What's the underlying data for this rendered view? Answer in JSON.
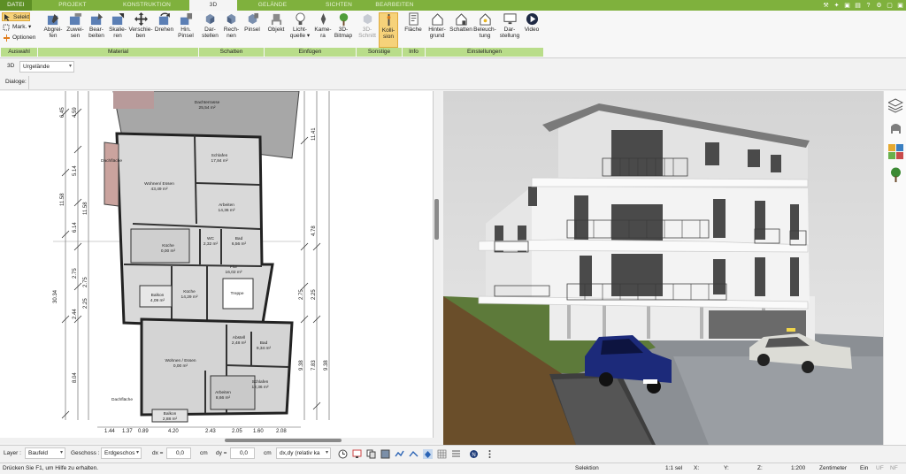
{
  "tabs": [
    {
      "label": "DATEI",
      "active": false
    },
    {
      "label": "PROJEKT",
      "active": false
    },
    {
      "label": "KONSTRUKTION",
      "active": false
    },
    {
      "label": "3D",
      "active": true
    },
    {
      "label": "GELÄNDE",
      "active": false
    },
    {
      "label": "SICHTEN",
      "active": false
    },
    {
      "label": "BEARBEITEN",
      "active": false
    }
  ],
  "ribbon": {
    "auswahl": {
      "label": "Auswahl",
      "selekt": "Selekt",
      "mark": "Mark.",
      "optionen": "Optionen"
    },
    "material": {
      "label": "Material",
      "buttons": [
        {
          "line1": "Abgrei-",
          "line2": "fen"
        },
        {
          "line1": "Zuwei-",
          "line2": "sen"
        },
        {
          "line1": "Bear-",
          "line2": "beiten"
        },
        {
          "line1": "Skalie-",
          "line2": "ren"
        },
        {
          "line1": "Verschie-",
          "line2": "ben"
        },
        {
          "line1": "Drehen",
          "line2": ""
        },
        {
          "line1": "Hin.",
          "line2": "Pinsel"
        }
      ]
    },
    "schatten": {
      "label": "Schatten",
      "buttons": [
        {
          "line1": "Dar-",
          "line2": "stellen"
        },
        {
          "line1": "Rech-",
          "line2": "nen"
        },
        {
          "line1": "Pinsel",
          "line2": ""
        }
      ]
    },
    "einfuegen": {
      "label": "Einfügen",
      "buttons": [
        {
          "line1": "Objekt",
          "line2": ""
        },
        {
          "line1": "Licht-",
          "line2": "quelle ▾"
        },
        {
          "line1": "Kame-",
          "line2": "ra"
        },
        {
          "line1": "3D-",
          "line2": "Bitmap"
        }
      ]
    },
    "sonstige": {
      "label": "Sonstige",
      "buttons": [
        {
          "line1": "3D-",
          "line2": "Schnitt"
        },
        {
          "line1": "Kolli-",
          "line2": "sion"
        }
      ]
    },
    "info": {
      "label": "Info",
      "buttons": [
        {
          "line1": "Fläche",
          "line2": ""
        }
      ]
    },
    "einstellungen": {
      "label": "Einstellungen",
      "buttons": [
        {
          "line1": "Hinter-",
          "line2": "grund"
        },
        {
          "line1": "Schatten",
          "line2": ""
        },
        {
          "line1": "Beleuch-",
          "line2": "tung"
        },
        {
          "line1": "Dar-",
          "line2": "stellung"
        },
        {
          "line1": "Video",
          "line2": ""
        }
      ]
    }
  },
  "row1": {
    "view_label": "3D",
    "terrain_value": "Urgelände"
  },
  "row2": {
    "dialoge_label": "Dialoge:"
  },
  "plan": {
    "rooms": [
      {
        "name": "Dachterrasse",
        "area": "25,54 m²"
      },
      {
        "name": "Schlafen",
        "area": "17,84 m²"
      },
      {
        "name": "Wohnen/ Essen",
        "area": "43,49 m²"
      },
      {
        "name": "Arbeiten",
        "area": "14,36 m²"
      },
      {
        "name": "Küche",
        "area": "0,00 m²"
      },
      {
        "name": "WC",
        "area": "2,32 m²"
      },
      {
        "name": "Bad",
        "area": "6,56 m²"
      },
      {
        "name": "Flur",
        "area": "16,02 m²"
      },
      {
        "name": "Küche",
        "area": "14,29 m²"
      },
      {
        "name": "Balkon",
        "area": "4,09 m²"
      },
      {
        "name": "Abstell",
        "area": "2,48 m²"
      },
      {
        "name": "Bad",
        "area": "9,34 m²"
      },
      {
        "name": "Wohnen / Essen",
        "area": "0,00 m²"
      },
      {
        "name": "Arbeiten",
        "area": "8,66 m²"
      },
      {
        "name": "Schlafen",
        "area": "12,36 m²"
      },
      {
        "name": "Balkon",
        "area": "2,88 m²"
      }
    ],
    "misc_labels": [
      "Dachfläche",
      "Dachfläche",
      "Treppe"
    ],
    "left_dims_outer": [
      "6.45",
      "11.58",
      "30.34"
    ],
    "left_dims_mid": [
      "4.59",
      "5.14",
      "6.14",
      "2.75",
      "2.44",
      "8.04"
    ],
    "left_dims_inner": [
      "2.75",
      "2.25",
      "11.58"
    ],
    "right_dims": [
      "11.41",
      "4.78",
      "2.75",
      "2.25",
      "9.38",
      "7.83",
      "9.38"
    ],
    "bottom_dims": [
      "1.44",
      "1.37",
      "0.89",
      "4.20",
      "2.43",
      "2.05",
      "1.60",
      "2.08"
    ]
  },
  "bottombar": {
    "layer_label": "Layer :",
    "layer_value": "Baufeld",
    "geschoss_label": "Geschoss :",
    "geschoss_value": "Erdgeschos",
    "dx_label": "dx =",
    "dx_value": "0,0",
    "dx_unit": "cm",
    "dy_label": "dy =",
    "dy_value": "0,0",
    "dy_unit": "cm",
    "mode_value": "dx,dy (relativ ka"
  },
  "statusbar": {
    "help": "Drücken Sie F1, um Hilfe zu erhalten.",
    "mode": "Selektion",
    "sel": "1:1 sel",
    "x": "X:",
    "y": "Y:",
    "z": "Z:",
    "scale": "1:200",
    "unit": "Zentimeter",
    "flags": [
      "Ein",
      "UF",
      "NF"
    ]
  },
  "colors": {
    "accent_green": "#7fb13d",
    "group_label_bg": "#b9dd8a",
    "highlight": "#f6d27a"
  }
}
